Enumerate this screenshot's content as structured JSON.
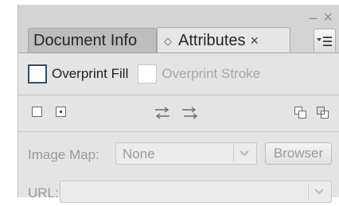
{
  "panel": {
    "tabs": [
      {
        "label": "Document Info",
        "active": false
      },
      {
        "label": "Attributes",
        "active": true
      }
    ],
    "window_controls": {
      "minimize": "–",
      "close": "×"
    }
  },
  "overprint": {
    "fill": {
      "label": "Overprint Fill",
      "checked": false,
      "enabled": true
    },
    "stroke": {
      "label": "Overprint Stroke",
      "checked": false,
      "enabled": false
    }
  },
  "icons": [
    "dont-show-center-icon",
    "show-center-icon",
    "reverse-path-direction-off-icon",
    "reverse-path-direction-on-icon",
    "use-non-zero-winding-fill-icon",
    "use-even-odd-fill-icon"
  ],
  "image_map": {
    "label": "Image Map:",
    "value": "None",
    "browser_label": "Browser"
  },
  "url": {
    "label": "URL:",
    "value": ""
  },
  "colors": {
    "panel_bg": "#d4d4d4",
    "content_bg": "#e4e4e4",
    "active_tab_bg": "#e6e6e6",
    "inactive_tab_bg": "#bdbdbd",
    "disabled_text": "#9a9a9a"
  }
}
